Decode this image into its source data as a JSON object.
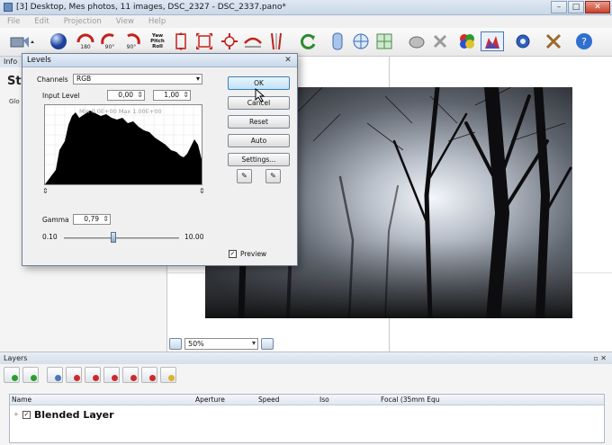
{
  "window": {
    "title": "[3] Desktop, Mes photos, 11 images, DSC_2327 - DSC_2337.pano*",
    "minimize": "–",
    "maximize": "□",
    "close": "✕"
  },
  "menu": {
    "items": [
      "File",
      "Edit",
      "Projection",
      "View",
      "Help"
    ]
  },
  "toolbar": {
    "icons": [
      "add-images-icon",
      "sphere-icon",
      "rotate-180-icon",
      "rotate-90-ccw-icon",
      "rotate-90-cw-icon",
      "yaw-pitch-roll-icon",
      "fit-height-icon",
      "fit-all-icon",
      "center-icon",
      "horizon-icon",
      "vertical-lines-icon",
      "refresh-icon",
      "cylinder-icon",
      "panorama-grid-icon",
      "stitch-icon",
      "mask-icon",
      "control-points-icon",
      "color-balance-icon",
      "levels-icon",
      "settings-gear-icon",
      "tools-icon",
      "help-icon"
    ],
    "labels": {
      "rot180": "180",
      "rot90a": "90°",
      "rot90b": "90°",
      "ypr": "Yaw Pitch Roll"
    }
  },
  "info_panel": {
    "header": "Info",
    "big_text": "St",
    "small_text": "Glo"
  },
  "preview": {
    "zoom_value": "50%"
  },
  "levels_dialog": {
    "title": "Levels",
    "close": "✕",
    "channels_label": "Channels",
    "channels_value": "RGB",
    "input_level_label": "Input Level",
    "input_level_min": "0,00",
    "input_level_max": "1,00",
    "histogram_meta": "Min 0.0E+00  Max 1.00E+00",
    "gamma_label": "Gamma",
    "gamma_value": "0,79",
    "gamma_min": "0.10",
    "gamma_max": "10.00",
    "gamma_level": 0.79,
    "buttons": {
      "ok": "OK",
      "cancel": "Cancel",
      "reset": "Reset",
      "auto": "Auto",
      "settings": "Settings..."
    },
    "preview_label": "Preview",
    "preview_checked": "✓"
  },
  "layers_panel": {
    "header": "Layers",
    "header_controls": "▫ ✕",
    "tool_icons": [
      "add-layer-icon",
      "add-layer-copy-icon",
      "layer-properties-icon",
      "layer-delete-icon",
      "layer-mask-icon",
      "layer-merge-icon",
      "layer-up-icon",
      "layer-down-icon",
      "layer-lock-icon"
    ],
    "columns": [
      "Name",
      "Aperture",
      "Speed",
      "Iso",
      "Focal (35mm Equ"
    ],
    "rows": [
      {
        "expander": "+",
        "checked": "✓",
        "name": "Blended Layer"
      }
    ]
  },
  "colors": {
    "titlebar": "#c9d7e8",
    "ok_button": "#bfe1f7",
    "toolbar_bg": "#e9e9e9"
  }
}
